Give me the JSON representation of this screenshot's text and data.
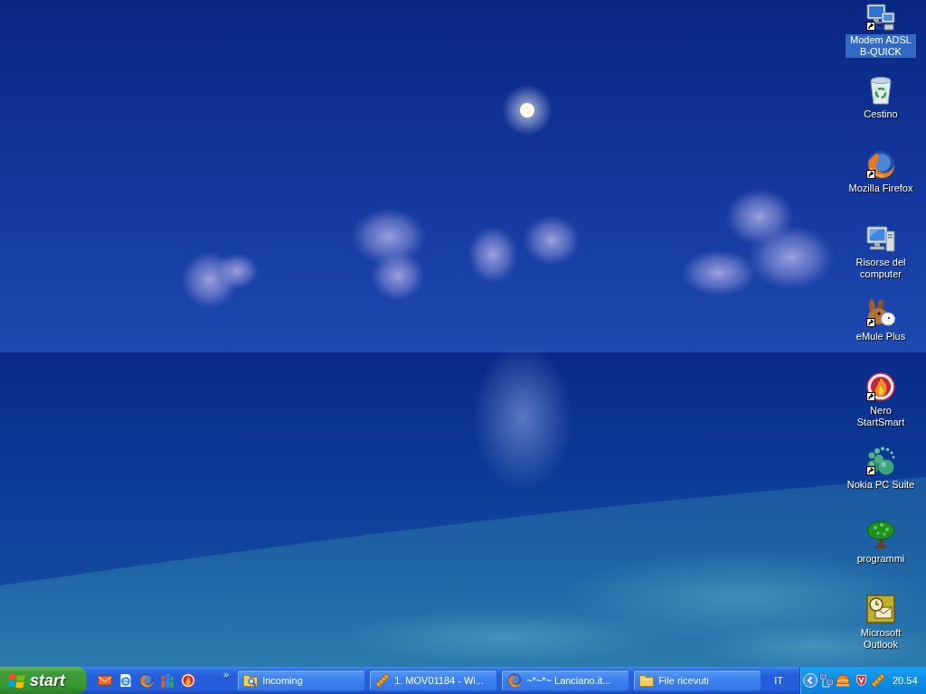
{
  "desktop_icons": [
    {
      "label": "Modem ADSL B-QUICK",
      "kind": "network",
      "shortcut": true,
      "selected": true
    },
    {
      "label": "Cestino",
      "kind": "bin",
      "shortcut": false,
      "selected": false
    },
    {
      "label": "Mozilla Firefox",
      "kind": "foxglobe",
      "shortcut": true,
      "selected": false
    },
    {
      "label": "Risorse del computer",
      "kind": "computer",
      "shortcut": false,
      "selected": false
    },
    {
      "label": "eMule Plus",
      "kind": "mule",
      "shortcut": true,
      "selected": false
    },
    {
      "label": "Nero StartSmart",
      "kind": "flamedisc",
      "shortcut": true,
      "selected": false
    },
    {
      "label": "Nokia PC Suite",
      "kind": "spheres",
      "shortcut": true,
      "selected": false
    },
    {
      "label": "programmi",
      "kind": "tree",
      "shortcut": false,
      "selected": false
    },
    {
      "label": "Microsoft Outlook",
      "kind": "clockcard",
      "shortcut": false,
      "selected": false
    }
  ],
  "taskbar": {
    "start": "start",
    "quick_launch_more": "»",
    "buttons": [
      {
        "label": "Incoming",
        "kind": "searchfolder",
        "selected": false
      },
      {
        "label": "1. MOV01184 - Wi...",
        "kind": "filmstrip",
        "selected": false
      },
      {
        "label": "~*~*~ Lanciano.it...",
        "kind": "foxglobe",
        "selected": false
      },
      {
        "label": "File ricevuti",
        "kind": "folder",
        "selected": false
      }
    ],
    "language": "IT",
    "clock": "20.54"
  }
}
